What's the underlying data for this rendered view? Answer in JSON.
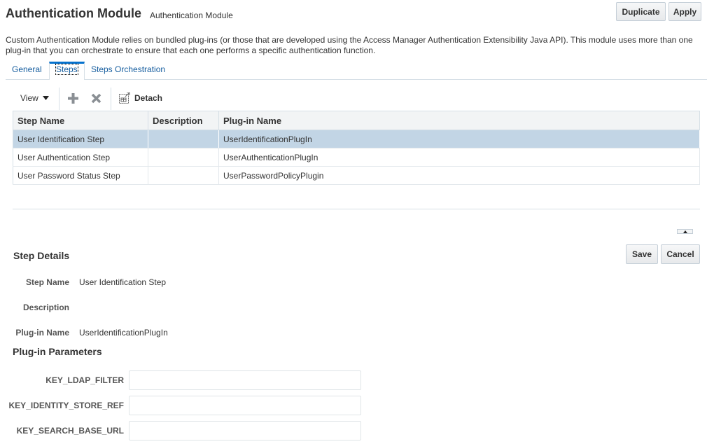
{
  "header": {
    "title": "Authentication Module",
    "subtitle": "Authentication Module",
    "duplicate_label": "Duplicate",
    "apply_label": "Apply"
  },
  "description": "Custom Authentication Module relies on bundled plug-ins (or those that are developed using the Access Manager Authentication Extensibility Java API). This module uses more than one plug-in that you can orchestrate to ensure that each one performs a specific authentication function.",
  "tabs": [
    {
      "label": "General",
      "active": false
    },
    {
      "label": "Steps",
      "active": true
    },
    {
      "label": "Steps Orchestration",
      "active": false
    }
  ],
  "toolbar": {
    "view_label": "View",
    "view_icon": "caret-down-icon",
    "add_icon": "plus-icon",
    "delete_icon": "x-icon",
    "detach_icon": "detach-icon",
    "detach_label": "Detach"
  },
  "table": {
    "columns": [
      "Step Name",
      "Description",
      "Plug-in Name"
    ],
    "rows": [
      {
        "step_name": "User Identification Step",
        "description": "",
        "plugin_name": "UserIdentificationPlugIn",
        "selected": true
      },
      {
        "step_name": "User Authentication Step",
        "description": "",
        "plugin_name": "UserAuthenticationPlugIn",
        "selected": false
      },
      {
        "step_name": "User Password Status Step",
        "description": "",
        "plugin_name": "UserPasswordPolicyPlugin",
        "selected": false
      }
    ]
  },
  "step_details": {
    "title": "Step Details",
    "save_label": "Save",
    "cancel_label": "Cancel",
    "collapse_icon": "caret-up-icon",
    "fields": [
      {
        "label": "Step Name",
        "value": "User Identification Step"
      },
      {
        "label": "Description",
        "value": ""
      },
      {
        "label": "Plug-in Name",
        "value": "UserIdentificationPlugIn"
      }
    ]
  },
  "plugin_parameters": {
    "title": "Plug-in Parameters",
    "params": [
      {
        "label": "KEY_LDAP_FILTER",
        "value": ""
      },
      {
        "label": "KEY_IDENTITY_STORE_REF",
        "value": ""
      },
      {
        "label": "KEY_SEARCH_BASE_URL",
        "value": ""
      }
    ]
  },
  "colors": {
    "accent": "#0572ce",
    "link": "#145c9e",
    "selected_row": "#c2d5e5",
    "border": "#d6dfe6"
  }
}
